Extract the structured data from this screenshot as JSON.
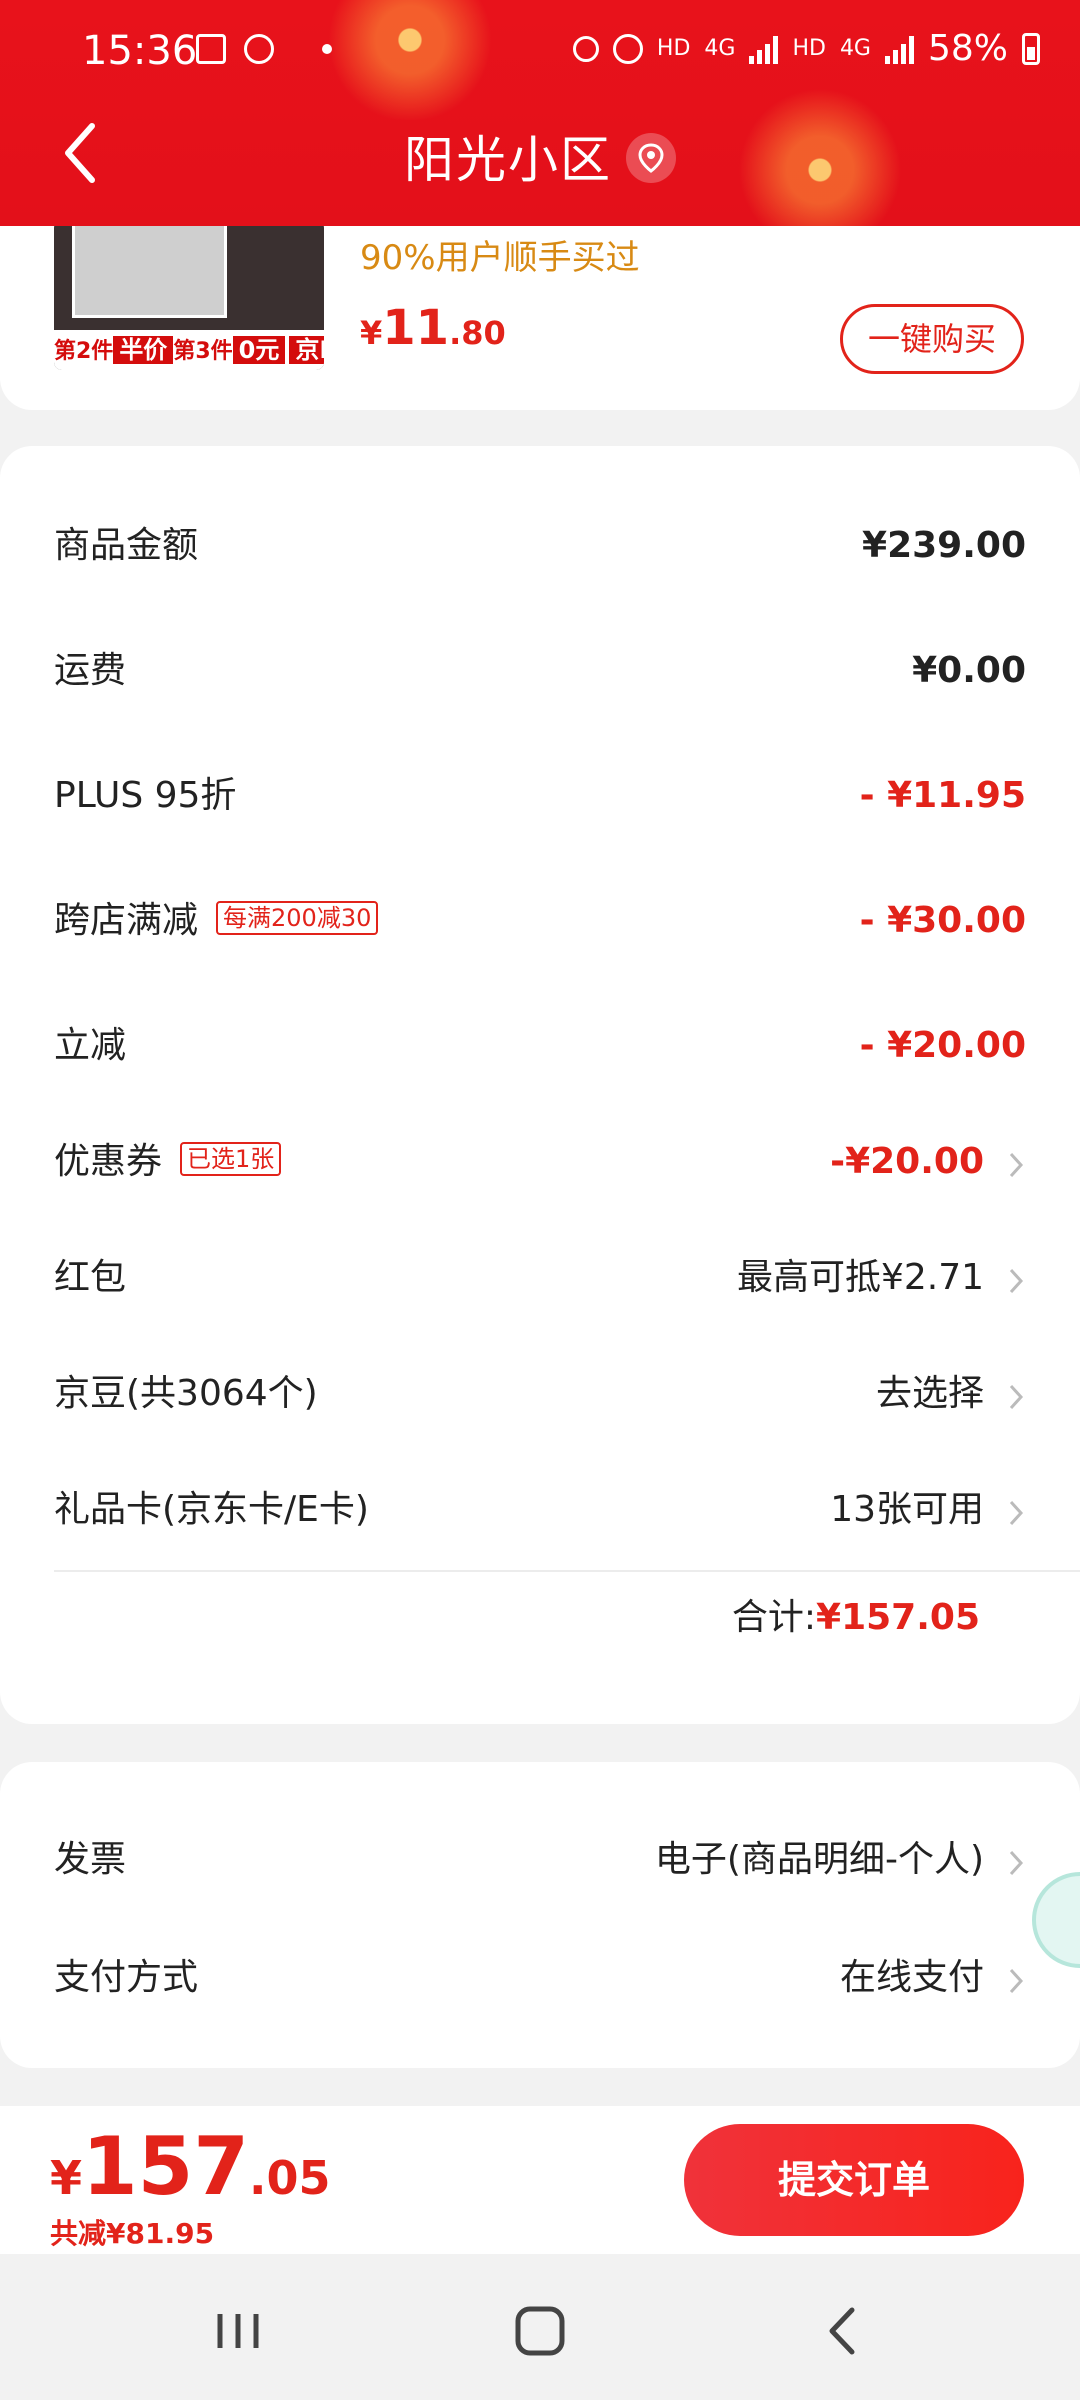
{
  "status_bar": {
    "time": "15:36",
    "network_1": "HD",
    "network_2": "4G",
    "network_3": "HD",
    "network_4": "4G",
    "battery": "58%"
  },
  "header": {
    "title": "阳光小区",
    "back_icon": "chevron-left-icon",
    "location_icon": "location-pin-icon"
  },
  "product": {
    "image_banner": {
      "part1": "第2件",
      "tag1": "半价",
      "part2": "第3件",
      "tag2": "0元",
      "tag3": "京D派送"
    },
    "tagline": "90%用户顺手买过",
    "price_currency": "¥",
    "price_int": "11",
    "price_dec": ".80",
    "buy_button": "一键购买"
  },
  "summary": {
    "rows": [
      {
        "label": "商品金额",
        "value": "¥239.00"
      },
      {
        "label": "运费",
        "value": "¥0.00"
      },
      {
        "label": "PLUS 95折",
        "value": "- ¥11.95"
      },
      {
        "label": "跨店满减",
        "badge": "每满200减30",
        "value": "- ¥30.00"
      },
      {
        "label": "立减",
        "value": "- ¥20.00"
      },
      {
        "label": "优惠券",
        "badge": "已选1张",
        "value": "-¥20.00"
      },
      {
        "label": "红包",
        "value": "最高可抵¥2.71"
      },
      {
        "label": "京豆(共3064个)",
        "value": "去选择"
      },
      {
        "label": "礼品卡(京东卡/E卡)",
        "value": "13张可用"
      }
    ],
    "total_label": "合计:",
    "total_value": "¥157.05"
  },
  "invoice": {
    "rows": [
      {
        "label": "发票",
        "value": "电子(商品明细-个人)"
      },
      {
        "label": "支付方式",
        "value": "在线支付"
      }
    ]
  },
  "bottom": {
    "price_currency": "¥",
    "price_int": "157",
    "price_dec": ".05",
    "saved": "共减¥81.95",
    "submit": "提交订单"
  },
  "nav": {
    "recent": "recent-apps-icon",
    "home": "home-icon",
    "back": "back-icon"
  },
  "colors": {
    "brand_red": "#e2231a",
    "header_red": "#e8121b",
    "tag_orange": "#d88a14"
  }
}
